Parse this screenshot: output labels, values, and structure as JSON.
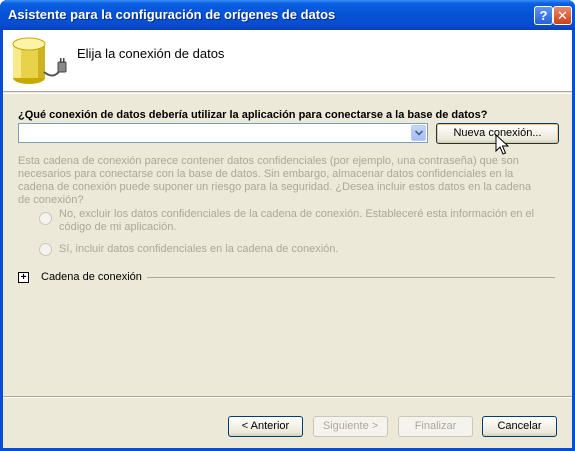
{
  "window": {
    "title": "Asistente para la configuración de orígenes de datos",
    "help_label": "?",
    "close_label": "✕"
  },
  "header": {
    "title": "Elija la conexión de datos",
    "icon": "database-plug-icon"
  },
  "connection": {
    "question": "¿Qué conexión de datos debería utilizar la aplicación para conectarse a la base de datos?",
    "selected_value": "",
    "new_connection_label": "Nueva conexión..."
  },
  "sensitive": {
    "warning": "Esta cadena de conexión parece contener datos confidenciales (por ejemplo, una contraseña) que son necesarios para conectarse con la base de datos. Sin embargo, almacenar datos confidenciales en la cadena de conexión puede suponer un riesgo para la seguridad. ¿Desea incluir estos datos en la cadena de conexión?",
    "option_no": "No, excluir los datos confidenciales de la cadena de conexión. Estableceré esta información en el código de mi aplicación.",
    "option_yes": "Sí, incluir datos confidenciales en la cadena de conexión."
  },
  "connection_string": {
    "expander_symbol": "+",
    "label": "Cadena de conexión"
  },
  "footer": {
    "back_label": "< Anterior",
    "next_label": "Siguiente >",
    "finish_label": "Finalizar",
    "cancel_label": "Cancelar"
  }
}
